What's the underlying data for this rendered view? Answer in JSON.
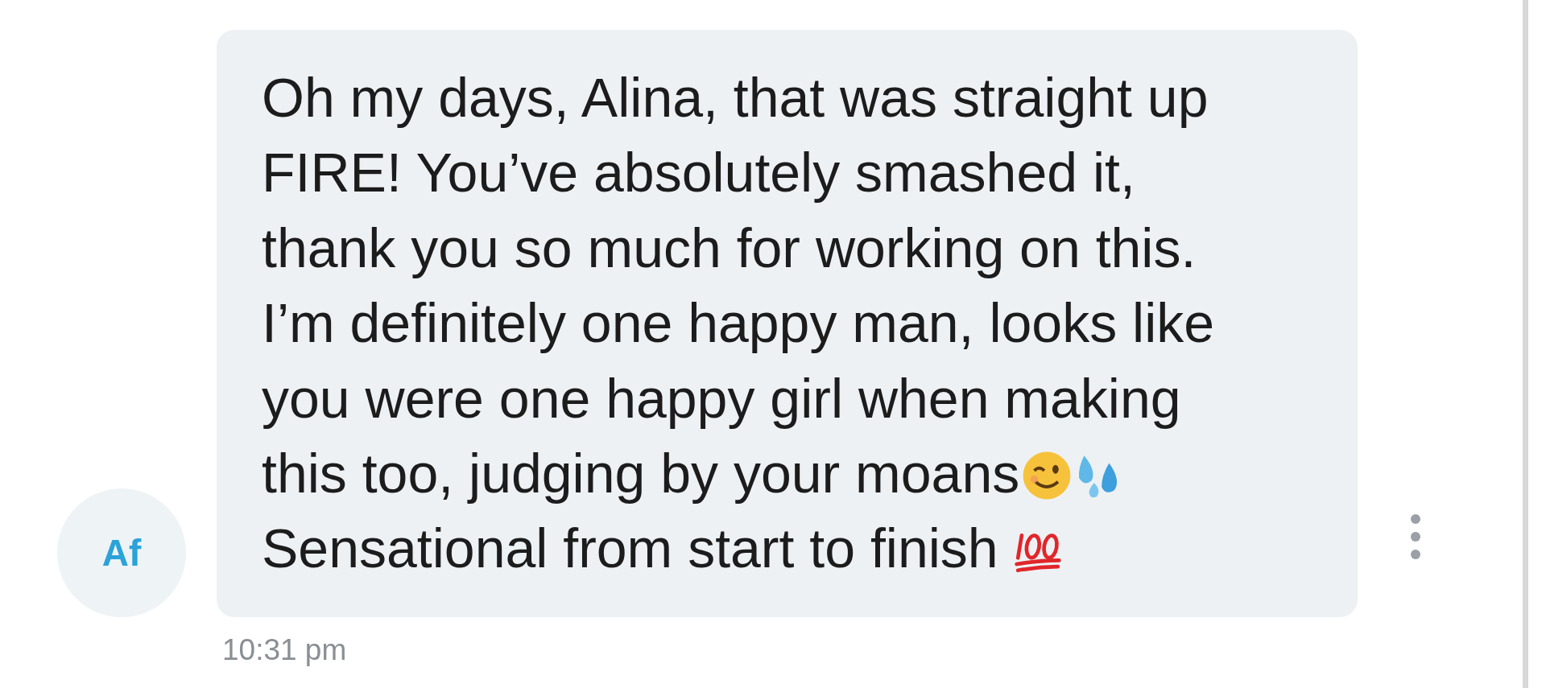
{
  "message": {
    "sender_initials": "Af",
    "text": "Oh my days, Alina, that was straight up\nFIRE! You’ve absolutely smashed it,\nthank you so much for working on this.\nI’m definitely one happy man, looks like\nyou were one happy girl when making",
    "text_last_line": "this too, judging by your moans",
    "closing_text": "Sensational from start to finish",
    "time": "10:31 pm"
  }
}
